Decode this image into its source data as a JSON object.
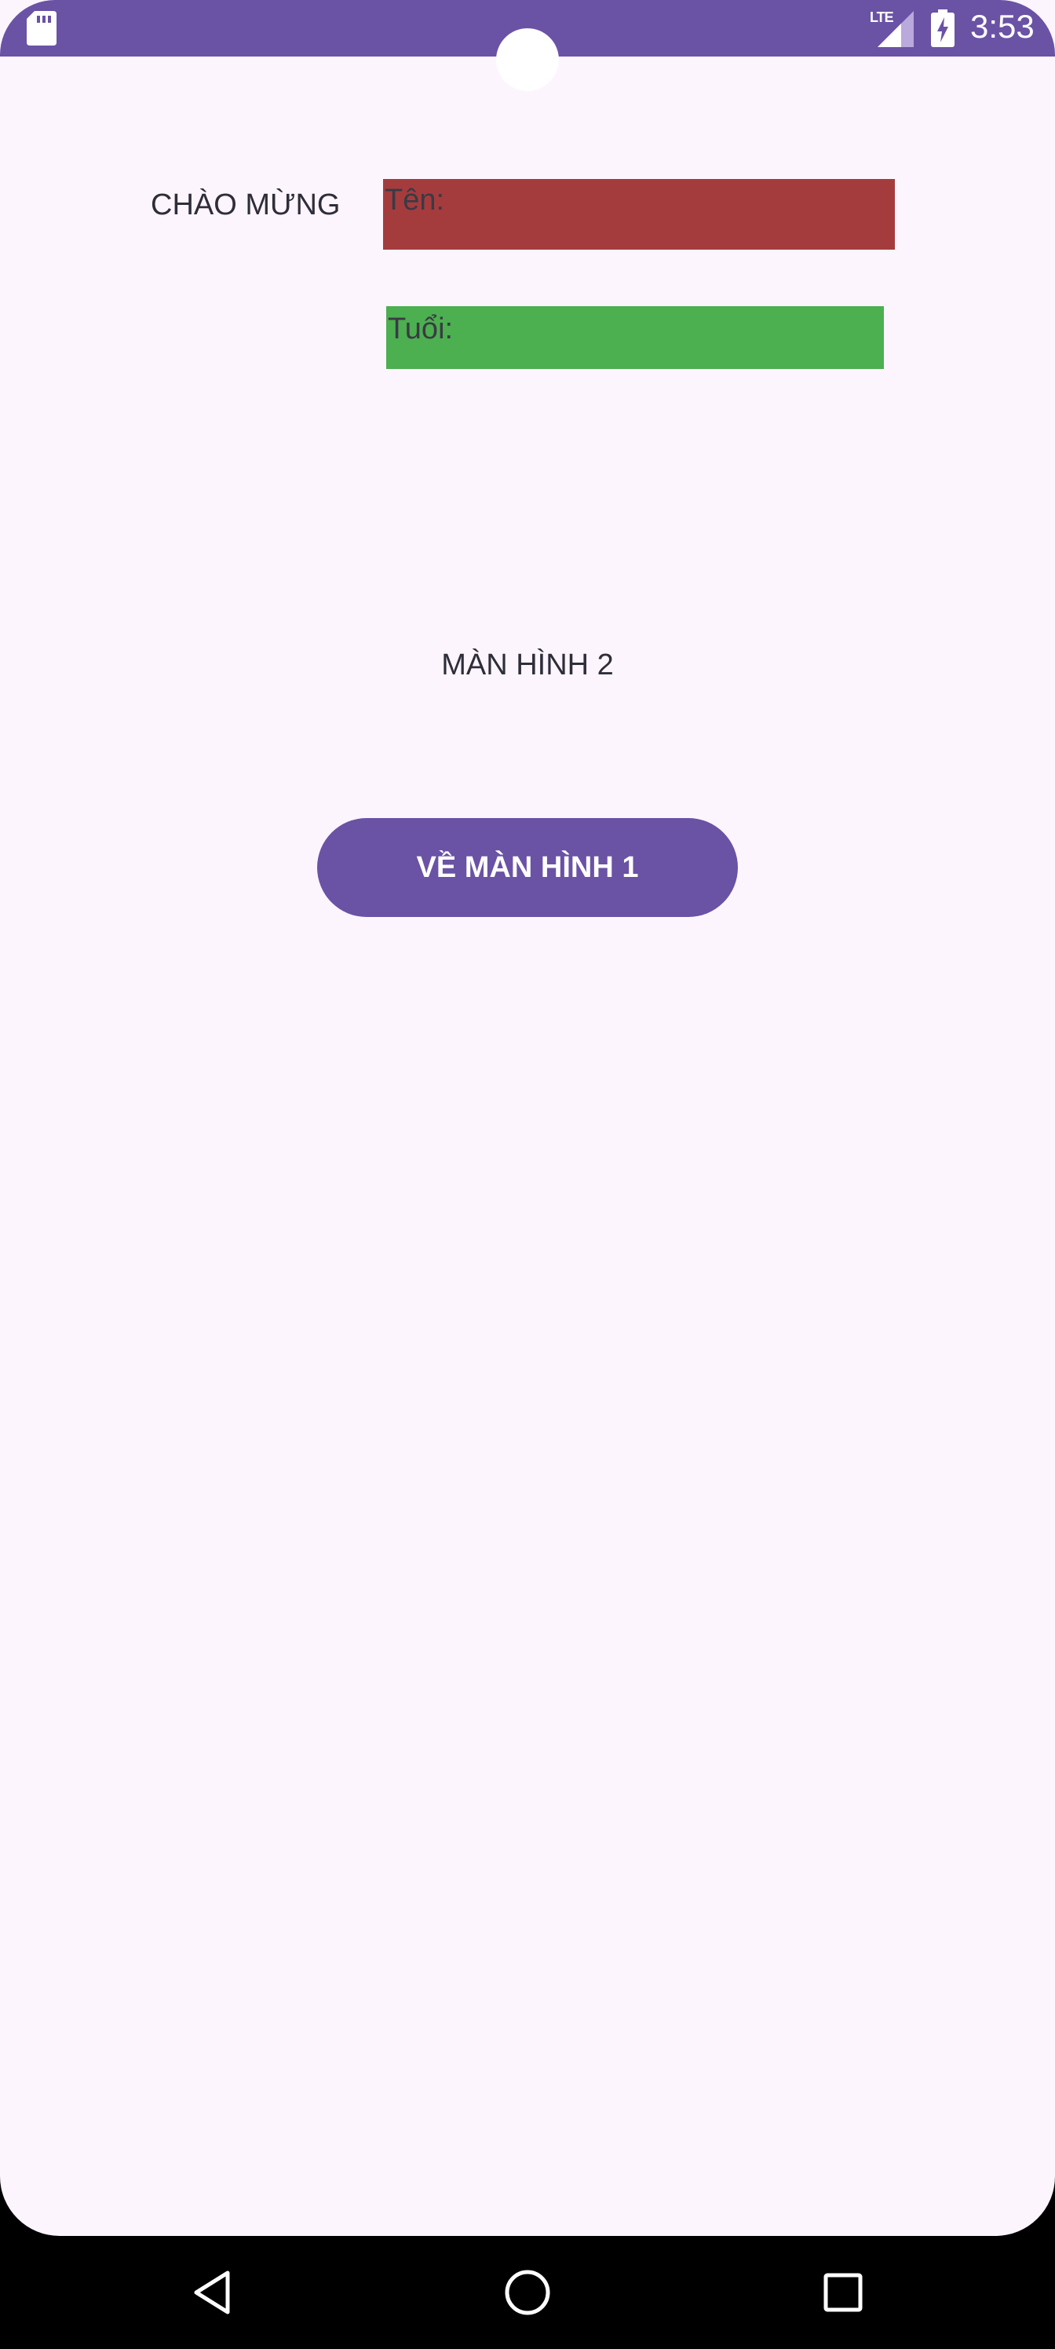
{
  "status_bar": {
    "time": "3:53",
    "network": "LTE",
    "icons": [
      "sd-card-icon",
      "signal-icon",
      "battery-charging-icon"
    ],
    "color": "#6a52a5"
  },
  "form": {
    "welcome_label": "CHÀO MỪNG",
    "name_field": {
      "label": "Tên:",
      "color": "#a43c3e"
    },
    "age_field": {
      "label": "Tuổi:",
      "color": "#4caf50"
    }
  },
  "screen_title": "MÀN HÌNH 2",
  "back_button": {
    "label": "VỀ MÀN HÌNH 1",
    "color": "#6a52a5"
  },
  "nav_bar": {
    "icons": [
      "back-triangle-icon",
      "home-circle-icon",
      "recents-square-icon"
    ]
  }
}
